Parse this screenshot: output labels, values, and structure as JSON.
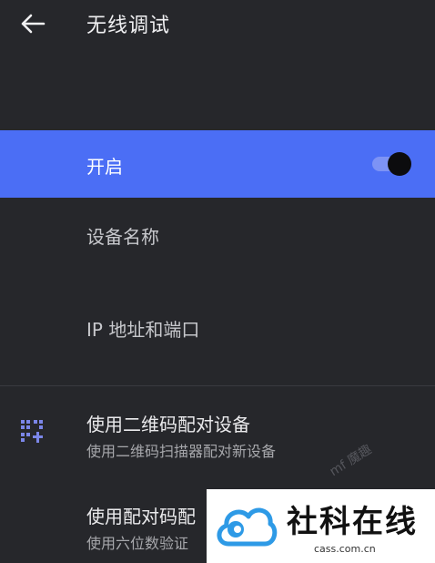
{
  "appbar": {
    "title": "无线调试",
    "back_icon": "arrow-left-icon"
  },
  "main_switch": {
    "label": "开启",
    "enabled": true
  },
  "settings": {
    "device_name": "设备名称",
    "ip_port": "IP 地址和端口"
  },
  "pair_qr": {
    "title": "使用二维码配对设备",
    "subtitle": "使用二维码扫描器配对新设备",
    "icon": "qr-code-icon"
  },
  "pair_code": {
    "title": "使用配对码配",
    "subtitle": "使用六位数验证"
  },
  "watermark": {
    "brand": "社科在线",
    "domain": "cass.com.cn",
    "faint_text": "mf  魔趣"
  },
  "colors": {
    "accent": "#4b6ef5",
    "background": "#26272b",
    "icon": "#7b86e8",
    "brand_blue": "#2e9ae6"
  }
}
